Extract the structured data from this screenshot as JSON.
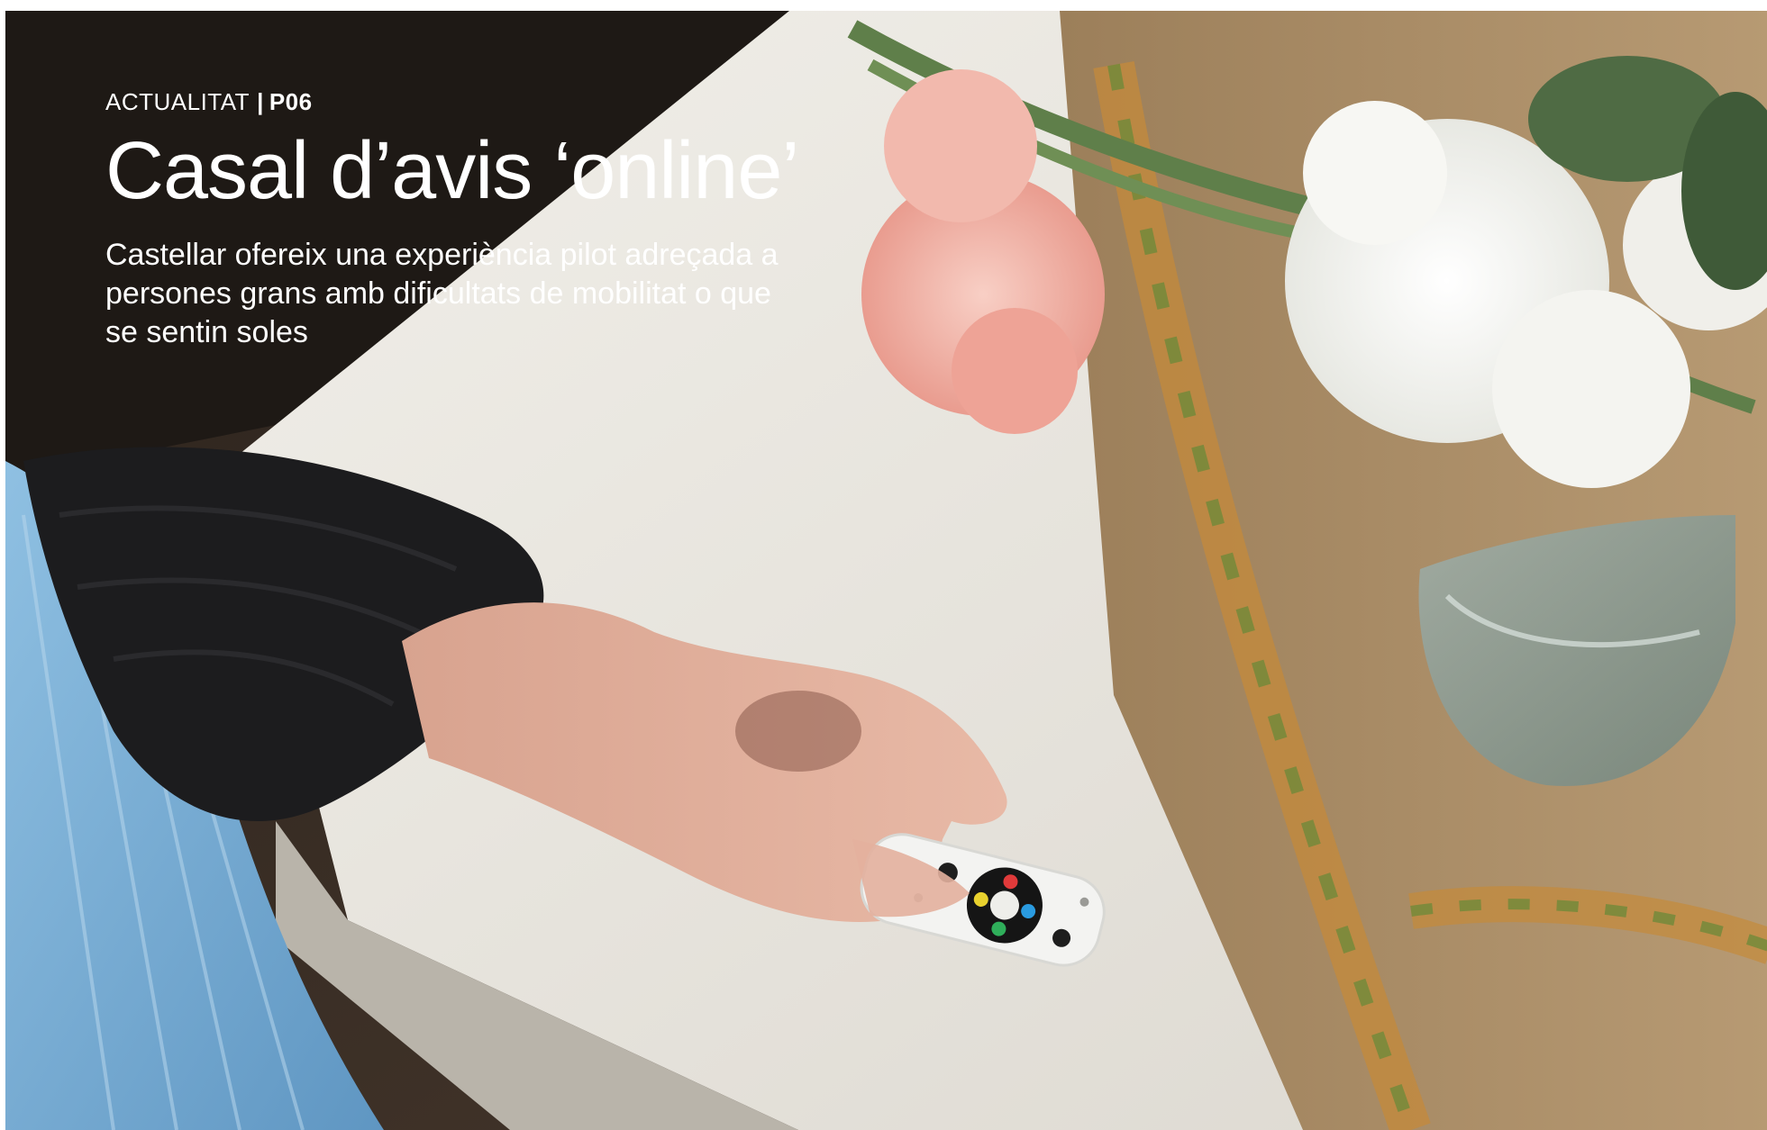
{
  "header": {
    "section": "ACTUALITAT",
    "separator": "|",
    "page_ref": "P06"
  },
  "headline": {
    "title": "Casal d’avis ‘online’",
    "subtitle": "Castellar ofereix una experiència pilot adreçada a persones grans amb dificultats de mobilitat o que se sentin soles"
  },
  "colors": {
    "text": "#ffffff",
    "table": "#e9e6df",
    "runner": "#a88b64",
    "sweater": "#1c1c1e",
    "blanket": "#7fb1d6",
    "carnation": "#f2b3a8"
  },
  "remote_buttons": [
    "#e03a3a",
    "#2a9be0",
    "#2fae5a",
    "#e8d12e"
  ]
}
